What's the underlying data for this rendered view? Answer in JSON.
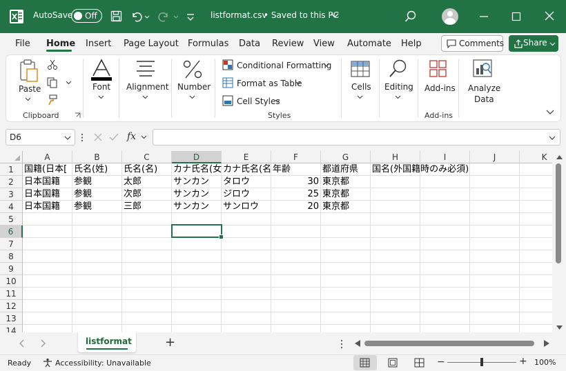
{
  "titlebar": {
    "autosave_label": "AutoSave",
    "autosave_state": "Off",
    "filename": "listformat.csv",
    "saved_status": "• Saved to this PC"
  },
  "menu": {
    "tabs": [
      "File",
      "Home",
      "Insert",
      "Page Layout",
      "Formulas",
      "Data",
      "Review",
      "View",
      "Automate",
      "Help"
    ],
    "active_tab": "Home",
    "comments_label": "Comments",
    "share_label": "Share"
  },
  "ribbon": {
    "paste": "Paste",
    "clipboard_group": "Clipboard",
    "font": "Font",
    "alignment": "Alignment",
    "number": "Number",
    "conditional_formatting": "Conditional Formatting",
    "format_as_table": "Format as Table",
    "cell_styles": "Cell Styles",
    "styles_group": "Styles",
    "cells": "Cells",
    "editing": "Editing",
    "addins": "Add-ins",
    "addins_group": "Add-ins",
    "analyze_data_1": "Analyze",
    "analyze_data_2": "Data"
  },
  "formula_bar": {
    "name_box": "D6",
    "fx": "fx",
    "content": ""
  },
  "sheet": {
    "columns": [
      "A",
      "B",
      "C",
      "D",
      "E",
      "F",
      "G",
      "H",
      "I",
      "J",
      "K"
    ],
    "rows": [
      "1",
      "2",
      "3",
      "4",
      "5",
      "6",
      "7",
      "8",
      "9",
      "10",
      "11",
      "12",
      "13",
      "14"
    ],
    "selected_cell": "D6",
    "cells": {
      "A1": "国籍(日本[",
      "B1": "氏名(姓)",
      "C1": "氏名(名)",
      "D1": "カナ氏名(女",
      "E1": "カナ氏名(名",
      "F1": "年齢",
      "G1": "都道府県",
      "H1": "国名(外国籍時のみ必須)",
      "A2": "日本国籍",
      "B2": "参観",
      "C2": "太郎",
      "D2": "サンカン",
      "E2": "タロウ",
      "F2": "30",
      "G2": "東京都",
      "A3": "日本国籍",
      "B3": "参観",
      "C3": "次郎",
      "D3": "サンカン",
      "E3": "ジロウ",
      "F3": "25",
      "G3": "東京都",
      "A4": "日本国籍",
      "B4": "参観",
      "C4": "三郎",
      "D4": "サンカン",
      "E4": "サンロウ",
      "F4": "20",
      "G4": "東京都"
    }
  },
  "sheet_tabs": {
    "active": "listformat",
    "add_label": "+"
  },
  "status": {
    "ready": "Ready",
    "accessibility": "Accessibility: Unavailable",
    "zoom": "100%"
  },
  "colors": {
    "brand": "#217346",
    "selection": "#217346"
  }
}
